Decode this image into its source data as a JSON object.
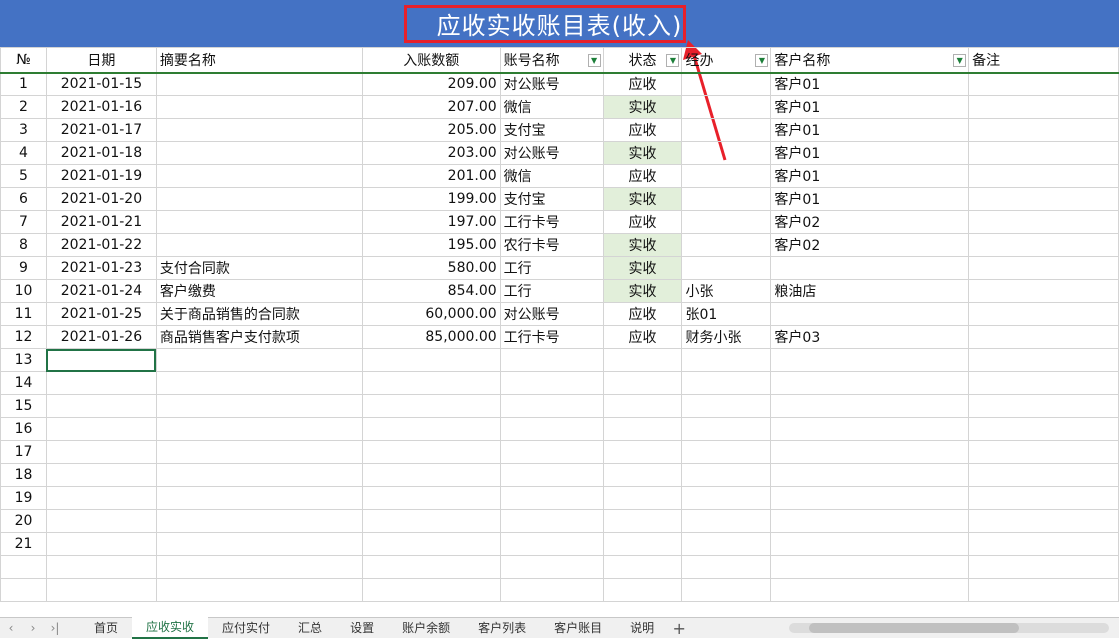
{
  "title": "应收实收账目表(收入)",
  "colors": {
    "title_bg": "#4472c4",
    "highlight": "#e8202a",
    "paid_bg": "#e2efda",
    "active_tab": "#217346"
  },
  "columns": [
    "№",
    "日期",
    "摘要名称",
    "入账数额",
    "账号名称",
    "状态",
    "经办",
    "客户名称",
    "备注"
  ],
  "rows": [
    {
      "no": "1",
      "date": "2021-01-15",
      "desc": "",
      "amount": "209.00",
      "account": "对公账号",
      "status": "应收",
      "handler": "",
      "customer": "客户01",
      "note": ""
    },
    {
      "no": "2",
      "date": "2021-01-16",
      "desc": "",
      "amount": "207.00",
      "account": "微信",
      "status": "实收",
      "handler": "",
      "customer": "客户01",
      "note": ""
    },
    {
      "no": "3",
      "date": "2021-01-17",
      "desc": "",
      "amount": "205.00",
      "account": "支付宝",
      "status": "应收",
      "handler": "",
      "customer": "客户01",
      "note": ""
    },
    {
      "no": "4",
      "date": "2021-01-18",
      "desc": "",
      "amount": "203.00",
      "account": "对公账号",
      "status": "实收",
      "handler": "",
      "customer": "客户01",
      "note": ""
    },
    {
      "no": "5",
      "date": "2021-01-19",
      "desc": "",
      "amount": "201.00",
      "account": "微信",
      "status": "应收",
      "handler": "",
      "customer": "客户01",
      "note": ""
    },
    {
      "no": "6",
      "date": "2021-01-20",
      "desc": "",
      "amount": "199.00",
      "account": "支付宝",
      "status": "实收",
      "handler": "",
      "customer": "客户01",
      "note": ""
    },
    {
      "no": "7",
      "date": "2021-01-21",
      "desc": "",
      "amount": "197.00",
      "account": "工行卡号",
      "status": "应收",
      "handler": "",
      "customer": "客户02",
      "note": ""
    },
    {
      "no": "8",
      "date": "2021-01-22",
      "desc": "",
      "amount": "195.00",
      "account": "农行卡号",
      "status": "实收",
      "handler": "",
      "customer": "客户02",
      "note": ""
    },
    {
      "no": "9",
      "date": "2021-01-23",
      "desc": "支付合同款",
      "amount": "580.00",
      "account": "工行",
      "status": "实收",
      "handler": "",
      "customer": "",
      "note": ""
    },
    {
      "no": "10",
      "date": "2021-01-24",
      "desc": "客户缴费",
      "amount": "854.00",
      "account": "工行",
      "status": "实收",
      "handler": "小张",
      "customer": "粮油店",
      "note": ""
    },
    {
      "no": "11",
      "date": "2021-01-25",
      "desc": "关于商品销售的合同款",
      "amount": "60,000.00",
      "account": "对公账号",
      "status": "应收",
      "handler": "张01",
      "customer": "",
      "note": ""
    },
    {
      "no": "12",
      "date": "2021-01-26",
      "desc": "商品销售客户支付款项",
      "amount": "85,000.00",
      "account": "工行卡号",
      "status": "应收",
      "handler": "财务小张",
      "customer": "客户03",
      "note": ""
    },
    {
      "no": "13",
      "date": "",
      "desc": "",
      "amount": "",
      "account": "",
      "status": "",
      "handler": "",
      "customer": "",
      "note": ""
    },
    {
      "no": "14",
      "date": "",
      "desc": "",
      "amount": "",
      "account": "",
      "status": "",
      "handler": "",
      "customer": "",
      "note": ""
    },
    {
      "no": "15",
      "date": "",
      "desc": "",
      "amount": "",
      "account": "",
      "status": "",
      "handler": "",
      "customer": "",
      "note": ""
    },
    {
      "no": "16",
      "date": "",
      "desc": "",
      "amount": "",
      "account": "",
      "status": "",
      "handler": "",
      "customer": "",
      "note": ""
    },
    {
      "no": "17",
      "date": "",
      "desc": "",
      "amount": "",
      "account": "",
      "status": "",
      "handler": "",
      "customer": "",
      "note": ""
    },
    {
      "no": "18",
      "date": "",
      "desc": "",
      "amount": "",
      "account": "",
      "status": "",
      "handler": "",
      "customer": "",
      "note": ""
    },
    {
      "no": "19",
      "date": "",
      "desc": "",
      "amount": "",
      "account": "",
      "status": "",
      "handler": "",
      "customer": "",
      "note": ""
    },
    {
      "no": "20",
      "date": "",
      "desc": "",
      "amount": "",
      "account": "",
      "status": "",
      "handler": "",
      "customer": "",
      "note": ""
    },
    {
      "no": "21",
      "date": "",
      "desc": "",
      "amount": "",
      "account": "",
      "status": "",
      "handler": "",
      "customer": "",
      "note": ""
    },
    {
      "no": "",
      "date": "",
      "desc": "",
      "amount": "",
      "account": "",
      "status": "",
      "handler": "",
      "customer": "",
      "note": ""
    },
    {
      "no": "",
      "date": "",
      "desc": "",
      "amount": "",
      "account": "",
      "status": "",
      "handler": "",
      "customer": "",
      "note": ""
    }
  ],
  "tabs": {
    "nav": [
      "‹",
      "›",
      "›|"
    ],
    "items": [
      "首页",
      "应收实收",
      "应付实付",
      "汇总",
      "设置",
      "账户余额",
      "客户列表",
      "客户账目",
      "说明"
    ],
    "active": "应收实收",
    "add": "+"
  }
}
